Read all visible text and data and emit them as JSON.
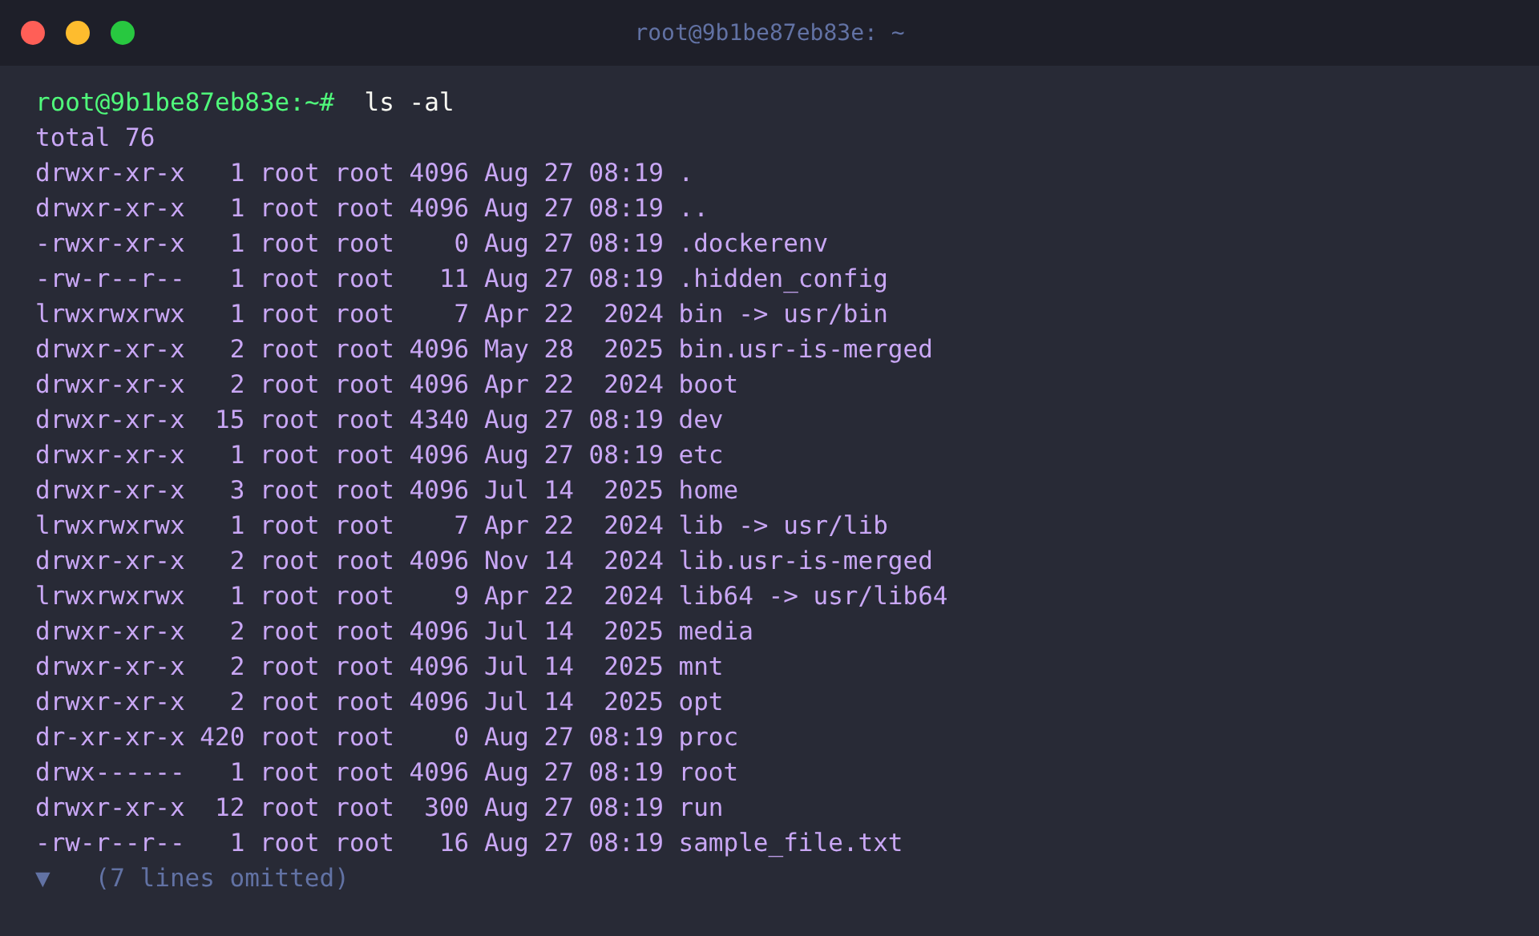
{
  "window": {
    "title": "root@9b1be87eb83e: ~"
  },
  "terminal": {
    "prompt": "root@9b1be87eb83e:~#",
    "command": "ls -al",
    "output": [
      "total 76",
      "drwxr-xr-x   1 root root 4096 Aug 27 08:19 .",
      "drwxr-xr-x   1 root root 4096 Aug 27 08:19 ..",
      "-rwxr-xr-x   1 root root    0 Aug 27 08:19 .dockerenv",
      "-rw-r--r--   1 root root   11 Aug 27 08:19 .hidden_config",
      "lrwxrwxrwx   1 root root    7 Apr 22  2024 bin -> usr/bin",
      "drwxr-xr-x   2 root root 4096 May 28  2025 bin.usr-is-merged",
      "drwxr-xr-x   2 root root 4096 Apr 22  2024 boot",
      "drwxr-xr-x  15 root root 4340 Aug 27 08:19 dev",
      "drwxr-xr-x   1 root root 4096 Aug 27 08:19 etc",
      "drwxr-xr-x   3 root root 4096 Jul 14  2025 home",
      "lrwxrwxrwx   1 root root    7 Apr 22  2024 lib -> usr/lib",
      "drwxr-xr-x   2 root root 4096 Nov 14  2024 lib.usr-is-merged",
      "lrwxrwxrwx   1 root root    9 Apr 22  2024 lib64 -> usr/lib64",
      "drwxr-xr-x   2 root root 4096 Jul 14  2025 media",
      "drwxr-xr-x   2 root root 4096 Jul 14  2025 mnt",
      "drwxr-xr-x   2 root root 4096 Jul 14  2025 opt",
      "dr-xr-xr-x 420 root root    0 Aug 27 08:19 proc",
      "drwx------   1 root root 4096 Aug 27 08:19 root",
      "drwxr-xr-x  12 root root  300 Aug 27 08:19 run",
      "-rw-r--r--   1 root root   16 Aug 27 08:19 sample_file.txt"
    ],
    "omitted": {
      "marker": "▼",
      "text": "(7 lines omitted)"
    }
  }
}
